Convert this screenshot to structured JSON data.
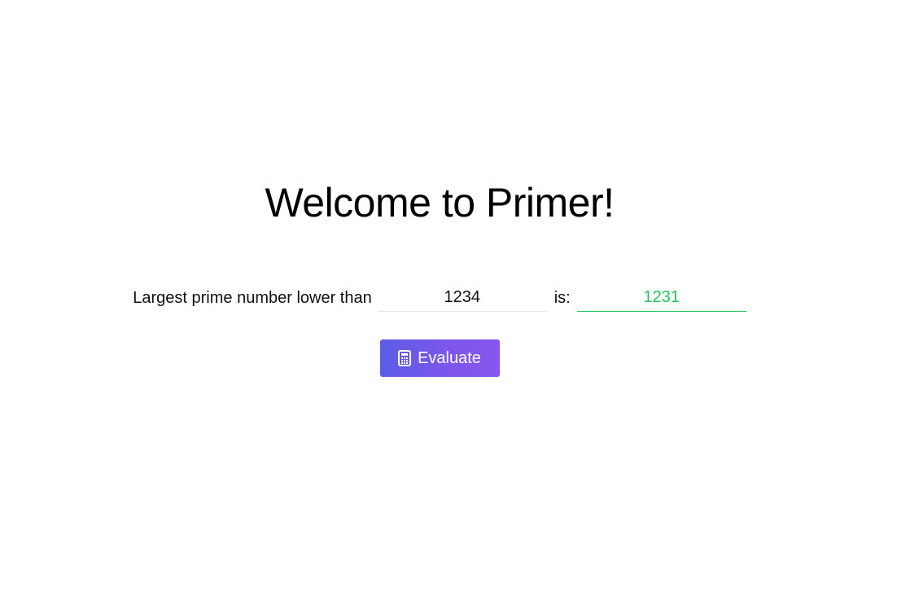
{
  "page": {
    "title": "Welcome to Primer!"
  },
  "form": {
    "prefix_label": "Largest prime number lower than",
    "input_value": "1234",
    "is_label": "is:",
    "result_value": "1231"
  },
  "actions": {
    "evaluate_label": "Evaluate",
    "evaluate_icon": "calculator-icon"
  },
  "colors": {
    "result_green": "#22c55e",
    "button_gradient_start": "#5b5ce6",
    "button_gradient_end": "#8a55ef"
  }
}
